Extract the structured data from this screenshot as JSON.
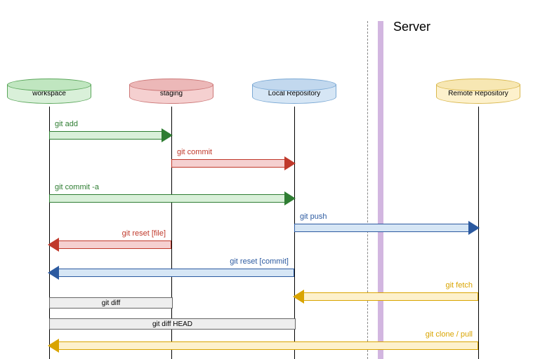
{
  "server_label": "Server",
  "lanes": {
    "workspace": "workspace",
    "staging": "staging",
    "local": "Local Repository",
    "remote": "Remote Repository"
  },
  "arrows": {
    "git_add": "git add",
    "git_commit": "git commit",
    "git_commit_a": "git commit -a",
    "git_push": "git push",
    "git_reset_file": "git reset [file]",
    "git_reset_commit": "git reset [commit]",
    "git_fetch": "git fetch",
    "git_clone_pull": "git clone / pull"
  },
  "spans": {
    "git_diff": "git diff",
    "git_diff_head": "git diff HEAD"
  },
  "chart_data": {
    "type": "table",
    "lanes": [
      "workspace",
      "staging",
      "Local Repository",
      "Remote Repository"
    ],
    "server_boundary_after": "Local Repository",
    "flows": [
      {
        "label": "git add",
        "from": "workspace",
        "to": "staging",
        "color": "green"
      },
      {
        "label": "git commit",
        "from": "staging",
        "to": "Local Repository",
        "color": "red"
      },
      {
        "label": "git commit -a",
        "from": "workspace",
        "to": "Local Repository",
        "color": "green"
      },
      {
        "label": "git push",
        "from": "Local Repository",
        "to": "Remote Repository",
        "color": "blue"
      },
      {
        "label": "git reset [file]",
        "from": "staging",
        "to": "workspace",
        "color": "red"
      },
      {
        "label": "git reset [commit]",
        "from": "Local Repository",
        "to": "workspace",
        "color": "blue"
      },
      {
        "label": "git fetch",
        "from": "Remote Repository",
        "to": "Local Repository",
        "color": "yellow"
      },
      {
        "label": "git clone / pull",
        "from": "Remote Repository",
        "to": "workspace",
        "color": "yellow"
      }
    ],
    "comparisons": [
      {
        "label": "git diff",
        "between": [
          "workspace",
          "staging"
        ]
      },
      {
        "label": "git diff HEAD",
        "between": [
          "workspace",
          "Local Repository"
        ]
      }
    ]
  }
}
